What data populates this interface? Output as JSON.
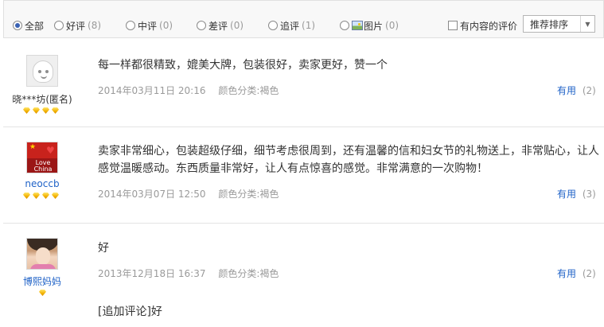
{
  "filters": {
    "options": [
      {
        "label": "全部",
        "count": "",
        "checked": true
      },
      {
        "label": "好评",
        "count": "(8)",
        "checked": false
      },
      {
        "label": "中评",
        "count": "(0)",
        "checked": false
      },
      {
        "label": "差评",
        "count": "(0)",
        "checked": false
      },
      {
        "label": "追评",
        "count": "(1)",
        "checked": false
      },
      {
        "label": "图片",
        "count": "(0)",
        "checked": false
      }
    ],
    "has_content_label": "有内容的评价",
    "sort_label": "推荐排序"
  },
  "reviews": [
    {
      "username": "晓***坊(匿名)",
      "text": "每一样都很精致，媲美大牌，包装很好，卖家更好，赞一个",
      "date": "2014年03月11日 20:16",
      "color_spec": "颜色分类:褐色",
      "useful_label": "有用",
      "useful_count": "(2)",
      "avatar": "default-avatar",
      "diamonds": 4
    },
    {
      "username": "neoccb",
      "text": "卖家非常细心，包装超级仔细，细节考虑很周到，还有温馨的信和妇女节的礼物送上，非常贴心，让人感觉温暖感动。东西质量非常好，让人有点惊喜的感觉。非常满意的一次购物！",
      "date": "2014年03月07日 12:50",
      "color_spec": "颜色分类:褐色",
      "useful_label": "有用",
      "useful_count": "(3)",
      "avatar": "love-china-avatar",
      "avatar_text": "Love China",
      "diamonds": 4
    },
    {
      "username": "博熙妈妈",
      "text": "好",
      "date": "2013年12月18日 16:37",
      "color_spec": "颜色分类:褐色",
      "useful_label": "有用",
      "useful_count": "(2)",
      "avatar": "photo-avatar",
      "diamonds": 1,
      "append_text": "[追加评论]好"
    }
  ],
  "colors": {
    "link": "#1f62c7",
    "muted": "#9a9a9a",
    "text": "#333333",
    "divider": "#e4e4e4",
    "diamond": "#f2b100"
  }
}
